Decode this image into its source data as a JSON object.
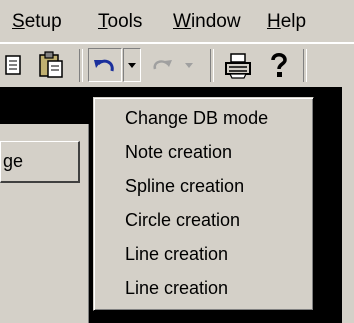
{
  "menubar": {
    "items": [
      {
        "label": "Setup",
        "mnemonic": "S",
        "rest": "etup"
      },
      {
        "label": "Tools",
        "mnemonic": "T",
        "rest": "ools"
      },
      {
        "label": "Window",
        "mnemonic": "W",
        "rest": "indow"
      },
      {
        "label": "Help",
        "mnemonic": "H",
        "rest": "elp"
      }
    ]
  },
  "toolbar": {
    "icons": [
      "copy-icon",
      "paste-icon",
      "undo-icon",
      "undo-dropdown-icon",
      "redo-icon",
      "redo-dropdown-icon",
      "print-icon",
      "help-icon"
    ]
  },
  "panel": {
    "button_label": "ge"
  },
  "undo_menu": {
    "items": [
      "Change DB mode",
      "Note creation",
      "Spline creation",
      "Circle creation",
      "Line creation",
      "Line creation"
    ]
  },
  "colors": {
    "face": "#d4d0c8",
    "shadow": "#808080",
    "highlight": "#ffffff",
    "undo_blue": "#1a2f9c"
  }
}
